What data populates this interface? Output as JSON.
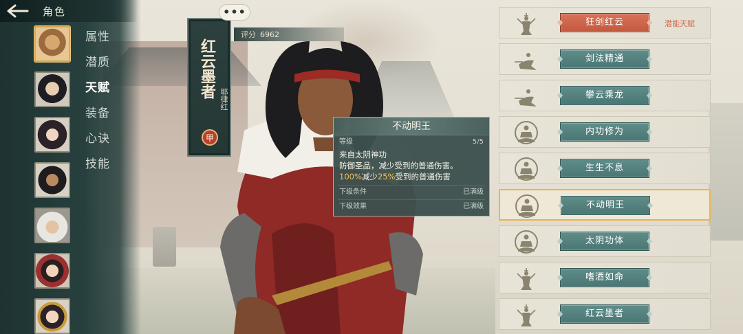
{
  "header": {
    "back_icon": "back-arrow-icon",
    "title": "角色"
  },
  "sidebar": {
    "menu": [
      {
        "label": "属性",
        "active": false
      },
      {
        "label": "潜质",
        "active": false
      },
      {
        "label": "天赋",
        "active": true
      },
      {
        "label": "装备",
        "active": false
      },
      {
        "label": "心诀",
        "active": false
      },
      {
        "label": "技能",
        "active": false
      }
    ],
    "avatars_count": 7,
    "selected_avatar": 0
  },
  "character": {
    "title": "红云墨者",
    "name": "耶律红",
    "rank": "甲",
    "score_label": "评分",
    "score": "6962"
  },
  "more_button": "•••",
  "tooltip": {
    "title": "不动明王",
    "level_label": "等级",
    "level_value": "5/5",
    "source": "来自太阴神功",
    "desc_line1": "防御圣品，减少受到的普通伤害。",
    "desc_line2_a": "100%",
    "desc_line2_b": "减少",
    "desc_line2_c": "25%",
    "desc_line2_d": "受到的普通伤害",
    "next_condition_label": "下级条件",
    "next_condition_value": "已满级",
    "next_effect_label": "下级效果",
    "next_effect_value": "已满级"
  },
  "talents": [
    {
      "label": "狂剑红云",
      "icon": "swordsman-icon",
      "style": "orange",
      "tag": "潜能天赋",
      "selected": false
    },
    {
      "label": "剑法精通",
      "icon": "lunging-swordsman-icon",
      "style": "teal",
      "tag": "",
      "selected": false
    },
    {
      "label": "攀云乘龙",
      "icon": "lunging-swordsman-icon",
      "style": "teal",
      "tag": "",
      "selected": false
    },
    {
      "label": "内功修为",
      "icon": "meditation-icon",
      "style": "teal",
      "tag": "",
      "selected": false
    },
    {
      "label": "生生不息",
      "icon": "meditation-icon",
      "style": "teal",
      "tag": "",
      "selected": false
    },
    {
      "label": "不动明王",
      "icon": "meditation-icon",
      "style": "teal",
      "tag": "",
      "selected": true
    },
    {
      "label": "太阴功体",
      "icon": "meditation-icon",
      "style": "teal",
      "tag": "",
      "selected": false
    },
    {
      "label": "嗜酒如命",
      "icon": "swordsman-icon",
      "style": "teal",
      "tag": "",
      "selected": false
    },
    {
      "label": "红云墨者",
      "icon": "swordsman-icon",
      "style": "teal",
      "tag": "",
      "selected": false
    }
  ],
  "colors": {
    "sidebar_bg": "#27403e",
    "teal_button": "#4a7673",
    "orange_button": "#c35a40",
    "selected_border": "#e5b554",
    "highlight_text": "#f0c25e"
  }
}
